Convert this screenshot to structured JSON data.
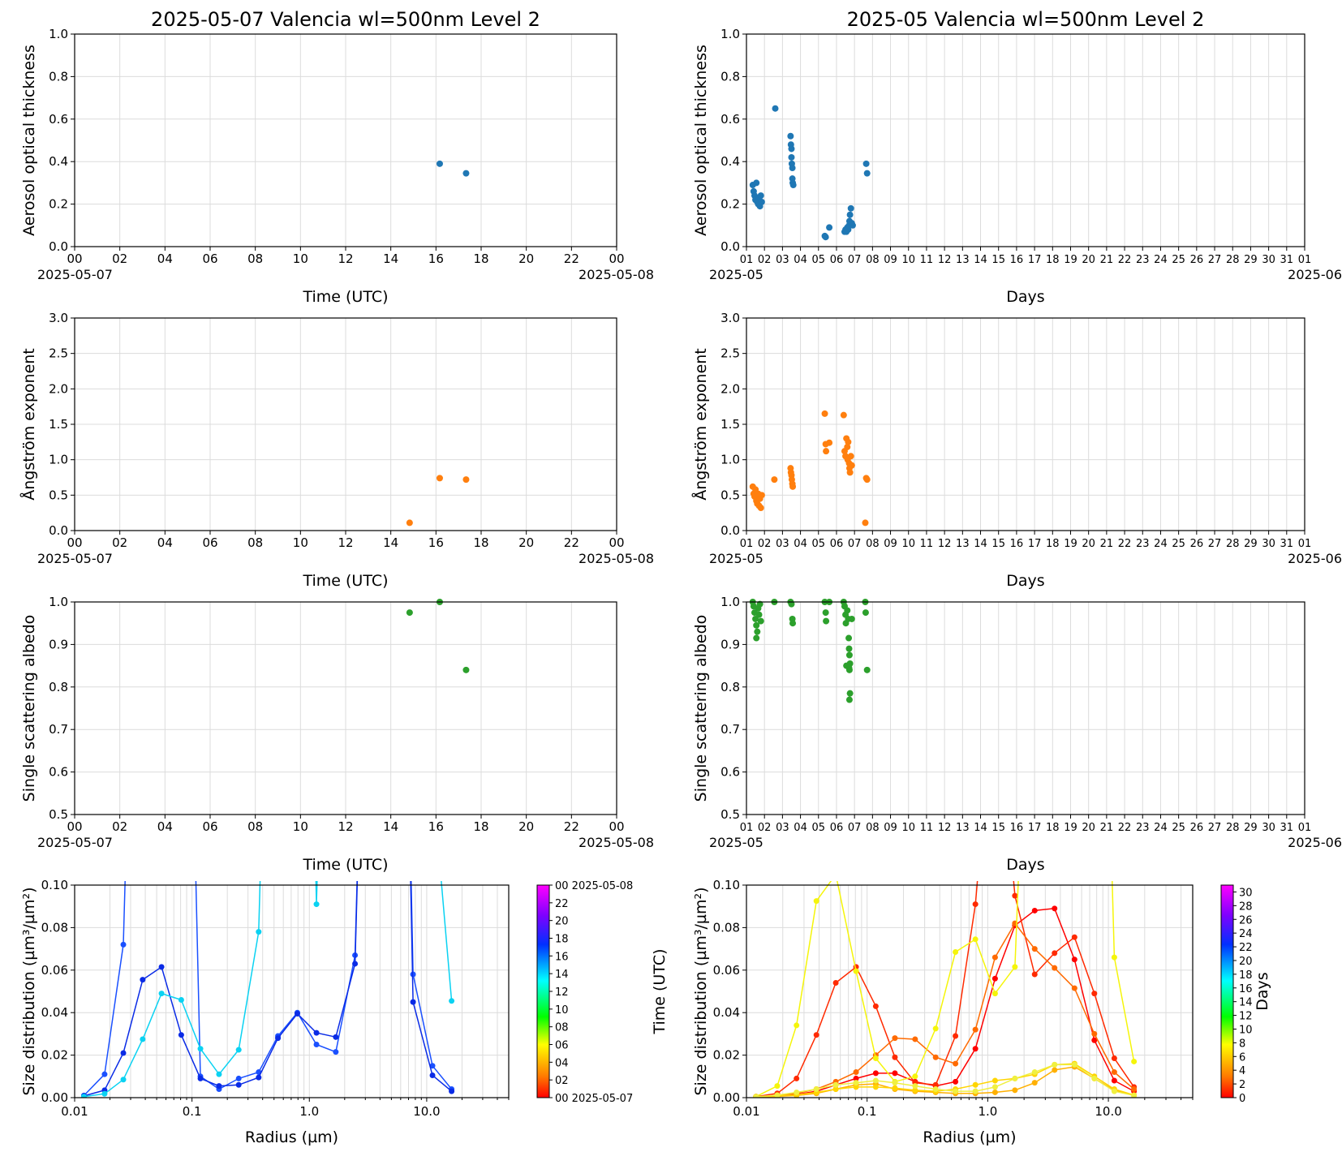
{
  "colors": {
    "aot": "#1f77b4",
    "ae": "#ff7f0e",
    "ssa": "#2ca02c"
  },
  "chart_data": [
    {
      "id": "daily-aot",
      "type": "scatter",
      "title": "2025-05-07  Valencia  wl=500nm  Level 2",
      "xlabel": "Time (UTC)",
      "ylabel": "Aerosol optical thickness",
      "xlim": [
        "2025-05-07 00:00",
        "2025-05-08 00:00"
      ],
      "ylim": [
        0,
        1.0
      ],
      "xticks": [
        "00",
        "02",
        "04",
        "06",
        "08",
        "10",
        "12",
        "14",
        "16",
        "18",
        "20",
        "22",
        "00"
      ],
      "yticks": [
        "0.0",
        "0.2",
        "0.4",
        "0.6",
        "0.8",
        "1.0"
      ],
      "date_start": "2025-05-07",
      "date_end": "2025-05-08",
      "grid": true,
      "points": [
        {
          "x": "2025-05-07 16:10",
          "y": 0.39
        },
        {
          "x": "2025-05-07 17:20",
          "y": 0.345
        }
      ]
    },
    {
      "id": "monthly-aot",
      "type": "scatter",
      "title": "2025-05  Valencia  wl=500nm  Level 2",
      "xlabel": "Days",
      "ylabel": "Aerosol optical thickness",
      "xlim": [
        "2025-05-01",
        "2025-06-01"
      ],
      "ylim": [
        0,
        1.0
      ],
      "xticks": [
        "01",
        "02",
        "03",
        "04",
        "05",
        "06",
        "07",
        "08",
        "09",
        "10",
        "11",
        "12",
        "13",
        "14",
        "15",
        "16",
        "17",
        "18",
        "19",
        "20",
        "21",
        "22",
        "23",
        "24",
        "25",
        "26",
        "27",
        "28",
        "29",
        "30",
        "31",
        "01"
      ],
      "yticks": [
        "0.0",
        "0.2",
        "0.4",
        "0.6",
        "0.8",
        "1.0"
      ],
      "date_start": "2025-05",
      "date_end": "2025-06",
      "grid": true,
      "points": [
        {
          "x": 1.35,
          "y": 0.29
        },
        {
          "x": 1.4,
          "y": 0.26
        },
        {
          "x": 1.45,
          "y": 0.24
        },
        {
          "x": 1.5,
          "y": 0.22
        },
        {
          "x": 1.55,
          "y": 0.3
        },
        {
          "x": 1.6,
          "y": 0.21
        },
        {
          "x": 1.65,
          "y": 0.2
        },
        {
          "x": 1.7,
          "y": 0.23
        },
        {
          "x": 1.75,
          "y": 0.19
        },
        {
          "x": 1.8,
          "y": 0.24
        },
        {
          "x": 1.85,
          "y": 0.21
        },
        {
          "x": 2.6,
          "y": 0.65
        },
        {
          "x": 3.45,
          "y": 0.52
        },
        {
          "x": 3.47,
          "y": 0.48
        },
        {
          "x": 3.5,
          "y": 0.46
        },
        {
          "x": 3.5,
          "y": 0.42
        },
        {
          "x": 3.52,
          "y": 0.39
        },
        {
          "x": 3.55,
          "y": 0.37
        },
        {
          "x": 3.55,
          "y": 0.32
        },
        {
          "x": 3.57,
          "y": 0.3
        },
        {
          "x": 3.6,
          "y": 0.29
        },
        {
          "x": 5.35,
          "y": 0.05
        },
        {
          "x": 5.4,
          "y": 0.045
        },
        {
          "x": 5.6,
          "y": 0.09
        },
        {
          "x": 6.45,
          "y": 0.07
        },
        {
          "x": 6.5,
          "y": 0.08
        },
        {
          "x": 6.55,
          "y": 0.07
        },
        {
          "x": 6.6,
          "y": 0.09
        },
        {
          "x": 6.65,
          "y": 0.08
        },
        {
          "x": 6.7,
          "y": 0.1
        },
        {
          "x": 6.72,
          "y": 0.12
        },
        {
          "x": 6.75,
          "y": 0.15
        },
        {
          "x": 6.8,
          "y": 0.18
        },
        {
          "x": 6.85,
          "y": 0.11
        },
        {
          "x": 6.9,
          "y": 0.1
        },
        {
          "x": 7.65,
          "y": 0.39
        },
        {
          "x": 7.7,
          "y": 0.345
        }
      ]
    },
    {
      "id": "daily-ae",
      "type": "scatter",
      "xlabel": "Time (UTC)",
      "ylabel": "Ångström exponent",
      "xlim": [
        "2025-05-07 00:00",
        "2025-05-08 00:00"
      ],
      "ylim": [
        0,
        3.0
      ],
      "xticks": [
        "00",
        "02",
        "04",
        "06",
        "08",
        "10",
        "12",
        "14",
        "16",
        "18",
        "20",
        "22",
        "00"
      ],
      "yticks": [
        "0.0",
        "0.5",
        "1.0",
        "1.5",
        "2.0",
        "2.5",
        "3.0"
      ],
      "date_start": "2025-05-07",
      "date_end": "2025-05-08",
      "grid": true,
      "points": [
        {
          "x": "2025-05-07 14:50",
          "y": 0.11
        },
        {
          "x": "2025-05-07 16:10",
          "y": 0.74
        },
        {
          "x": "2025-05-07 17:20",
          "y": 0.72
        }
      ]
    },
    {
      "id": "monthly-ae",
      "type": "scatter",
      "xlabel": "Days",
      "ylabel": "Ångström exponent",
      "xlim": [
        "2025-05-01",
        "2025-06-01"
      ],
      "ylim": [
        0,
        3.0
      ],
      "xticks": [
        "01",
        "02",
        "03",
        "04",
        "05",
        "06",
        "07",
        "08",
        "09",
        "10",
        "11",
        "12",
        "13",
        "14",
        "15",
        "16",
        "17",
        "18",
        "19",
        "20",
        "21",
        "22",
        "23",
        "24",
        "25",
        "26",
        "27",
        "28",
        "29",
        "30",
        "31",
        "01"
      ],
      "yticks": [
        "0.0",
        "0.5",
        "1.0",
        "1.5",
        "2.0",
        "2.5",
        "3.0"
      ],
      "date_start": "2025-05",
      "date_end": "2025-06",
      "grid": true,
      "points": [
        {
          "x": 1.35,
          "y": 0.62
        },
        {
          "x": 1.4,
          "y": 0.52
        },
        {
          "x": 1.45,
          "y": 0.48
        },
        {
          "x": 1.5,
          "y": 0.58
        },
        {
          "x": 1.55,
          "y": 0.42
        },
        {
          "x": 1.6,
          "y": 0.38
        },
        {
          "x": 1.65,
          "y": 0.52
        },
        {
          "x": 1.7,
          "y": 0.35
        },
        {
          "x": 1.75,
          "y": 0.45
        },
        {
          "x": 1.8,
          "y": 0.32
        },
        {
          "x": 1.85,
          "y": 0.5
        },
        {
          "x": 2.55,
          "y": 0.72
        },
        {
          "x": 3.45,
          "y": 0.88
        },
        {
          "x": 3.47,
          "y": 0.82
        },
        {
          "x": 3.5,
          "y": 0.78
        },
        {
          "x": 3.52,
          "y": 0.72
        },
        {
          "x": 3.55,
          "y": 0.66
        },
        {
          "x": 3.57,
          "y": 0.62
        },
        {
          "x": 5.35,
          "y": 1.65
        },
        {
          "x": 5.4,
          "y": 1.22
        },
        {
          "x": 5.42,
          "y": 1.12
        },
        {
          "x": 5.6,
          "y": 1.24
        },
        {
          "x": 6.4,
          "y": 1.63
        },
        {
          "x": 6.45,
          "y": 1.12
        },
        {
          "x": 6.5,
          "y": 1.05
        },
        {
          "x": 6.55,
          "y": 1.3
        },
        {
          "x": 6.6,
          "y": 1.18
        },
        {
          "x": 6.62,
          "y": 1.0
        },
        {
          "x": 6.65,
          "y": 1.25
        },
        {
          "x": 6.7,
          "y": 0.95
        },
        {
          "x": 6.72,
          "y": 0.88
        },
        {
          "x": 6.75,
          "y": 0.82
        },
        {
          "x": 6.8,
          "y": 1.05
        },
        {
          "x": 6.85,
          "y": 0.92
        },
        {
          "x": 7.6,
          "y": 0.11
        },
        {
          "x": 7.65,
          "y": 0.74
        },
        {
          "x": 7.7,
          "y": 0.72
        }
      ]
    },
    {
      "id": "daily-ssa",
      "type": "scatter",
      "xlabel": "Time (UTC)",
      "ylabel": "Single scattering albedo",
      "xlim": [
        "2025-05-07 00:00",
        "2025-05-08 00:00"
      ],
      "ylim": [
        0.5,
        1.0
      ],
      "xticks": [
        "00",
        "02",
        "04",
        "06",
        "08",
        "10",
        "12",
        "14",
        "16",
        "18",
        "20",
        "22",
        "00"
      ],
      "yticks": [
        "0.5",
        "0.6",
        "0.7",
        "0.8",
        "0.9",
        "1.0"
      ],
      "date_start": "2025-05-07",
      "date_end": "2025-05-08",
      "grid": true,
      "points": [
        {
          "x": "2025-05-07 14:50",
          "y": 0.975
        },
        {
          "x": "2025-05-07 16:10",
          "y": 1.0
        },
        {
          "x": "2025-05-07 17:20",
          "y": 0.84
        }
      ]
    },
    {
      "id": "monthly-ssa",
      "type": "scatter",
      "xlabel": "Days",
      "ylabel": "Single scattering albedo",
      "xlim": [
        "2025-05-01",
        "2025-06-01"
      ],
      "ylim": [
        0.5,
        1.0
      ],
      "xticks": [
        "01",
        "02",
        "03",
        "04",
        "05",
        "06",
        "07",
        "08",
        "09",
        "10",
        "11",
        "12",
        "13",
        "14",
        "15",
        "16",
        "17",
        "18",
        "19",
        "20",
        "21",
        "22",
        "23",
        "24",
        "25",
        "26",
        "27",
        "28",
        "29",
        "30",
        "31",
        "01"
      ],
      "yticks": [
        "0.5",
        "0.6",
        "0.7",
        "0.8",
        "0.9",
        "1.0"
      ],
      "date_start": "2025-05",
      "date_end": "2025-06",
      "grid": true,
      "points": [
        {
          "x": 1.35,
          "y": 1.0
        },
        {
          "x": 1.4,
          "y": 0.99
        },
        {
          "x": 1.45,
          "y": 0.975
        },
        {
          "x": 1.5,
          "y": 0.96
        },
        {
          "x": 1.55,
          "y": 0.945
        },
        {
          "x": 1.6,
          "y": 0.93
        },
        {
          "x": 1.55,
          "y": 0.915
        },
        {
          "x": 1.65,
          "y": 0.985
        },
        {
          "x": 1.7,
          "y": 0.97
        },
        {
          "x": 1.75,
          "y": 0.995
        },
        {
          "x": 1.8,
          "y": 0.955
        },
        {
          "x": 2.55,
          "y": 1.0
        },
        {
          "x": 3.45,
          "y": 1.0
        },
        {
          "x": 3.5,
          "y": 0.995
        },
        {
          "x": 3.55,
          "y": 0.96
        },
        {
          "x": 3.57,
          "y": 0.95
        },
        {
          "x": 5.35,
          "y": 1.0
        },
        {
          "x": 5.4,
          "y": 0.975
        },
        {
          "x": 5.42,
          "y": 0.955
        },
        {
          "x": 5.6,
          "y": 1.0
        },
        {
          "x": 6.4,
          "y": 1.0
        },
        {
          "x": 6.45,
          "y": 0.99
        },
        {
          "x": 6.5,
          "y": 0.97
        },
        {
          "x": 6.52,
          "y": 0.95
        },
        {
          "x": 6.55,
          "y": 0.85
        },
        {
          "x": 6.6,
          "y": 0.98
        },
        {
          "x": 6.65,
          "y": 0.96
        },
        {
          "x": 6.68,
          "y": 0.915
        },
        {
          "x": 6.7,
          "y": 0.89
        },
        {
          "x": 6.72,
          "y": 0.875
        },
        {
          "x": 6.75,
          "y": 0.855
        },
        {
          "x": 6.7,
          "y": 0.845
        },
        {
          "x": 6.72,
          "y": 0.84
        },
        {
          "x": 6.75,
          "y": 0.785
        },
        {
          "x": 6.72,
          "y": 0.77
        },
        {
          "x": 6.85,
          "y": 0.96
        },
        {
          "x": 7.6,
          "y": 1.0
        },
        {
          "x": 7.62,
          "y": 0.975
        },
        {
          "x": 7.7,
          "y": 0.84
        }
      ]
    },
    {
      "id": "daily-sd",
      "type": "line",
      "xlabel": "Radius (µm)",
      "ylabel": "Size distribution (µm³/µm²)",
      "xscale": "log",
      "xlim": [
        0.01,
        50
      ],
      "ylim": [
        0,
        0.1
      ],
      "xticks": [
        "0.01",
        "0.1",
        "1.0",
        "10.0"
      ],
      "yticks": [
        "0.00",
        "0.02",
        "0.04",
        "0.06",
        "0.08",
        "0.10"
      ],
      "colorbar": {
        "label": "Time (UTC)",
        "ticks": [
          "00 2025-05-07",
          "02",
          "04",
          "06",
          "08",
          "10",
          "12",
          "14",
          "16",
          "18",
          "20",
          "22",
          "00 2025-05-08"
        ]
      },
      "x": [
        0.012,
        0.018,
        0.026,
        0.038,
        0.055,
        0.081,
        0.118,
        0.17,
        0.25,
        0.37,
        0.54,
        0.79,
        1.15,
        1.68,
        2.45,
        3.58,
        5.24,
        7.65,
        11.2,
        16.3
      ],
      "series": [
        {
          "color": "#1a50ff",
          "values": [
            0.001,
            0.011,
            0.072,
            0.4,
            0.5,
            0.4,
            0.01,
            0.004,
            0.009,
            0.012,
            0.029,
            0.04,
            0.025,
            0.0215,
            0.067,
            0.4,
            0.5,
            0.058,
            0.015,
            0.004
          ]
        },
        {
          "color": "#0a2be6",
          "values": [
            0.0008,
            0.0035,
            0.021,
            0.0555,
            0.0615,
            0.0295,
            0.009,
            0.0055,
            0.006,
            0.0095,
            0.028,
            0.0395,
            0.0305,
            0.0285,
            0.063,
            0.4,
            0.5,
            0.045,
            0.0105,
            0.003
          ]
        },
        {
          "color": "#0ad2f2",
          "values": [
            0.0005,
            0.0018,
            0.0085,
            0.0275,
            0.049,
            0.046,
            0.023,
            0.011,
            0.0225,
            0.078,
            0.4,
            0.5,
            0.091,
            0.4,
            0.5,
            0.6,
            0.5,
            0.4,
            0.15,
            0.0455
          ]
        }
      ]
    },
    {
      "id": "monthly-sd",
      "type": "line",
      "xlabel": "Radius (µm)",
      "ylabel": "Size distribution (µm³/µm²)",
      "xscale": "log",
      "xlim": [
        0.01,
        50
      ],
      "ylim": [
        0,
        0.1
      ],
      "xticks": [
        "0.01",
        "0.1",
        "1.0",
        "10.0"
      ],
      "yticks": [
        "0.00",
        "0.02",
        "0.04",
        "0.06",
        "0.08",
        "0.10"
      ],
      "colorbar": {
        "label": "Days",
        "ticks": [
          "0",
          "2",
          "4",
          "6",
          "8",
          "10",
          "12",
          "14",
          "16",
          "18",
          "20",
          "22",
          "24",
          "26",
          "28",
          "30"
        ]
      },
      "x": [
        0.012,
        0.018,
        0.026,
        0.038,
        0.055,
        0.081,
        0.118,
        0.17,
        0.25,
        0.37,
        0.54,
        0.79,
        1.15,
        1.68,
        2.45,
        3.58,
        5.24,
        7.65,
        11.2,
        16.3
      ],
      "series": [
        {
          "color": "#ff0000",
          "values": [
            0.0005,
            0.001,
            0.0015,
            0.003,
            0.006,
            0.009,
            0.0115,
            0.0115,
            0.0075,
            0.0055,
            0.0075,
            0.023,
            0.056,
            0.081,
            0.088,
            0.089,
            0.065,
            0.027,
            0.008,
            0.003
          ]
        },
        {
          "color": "#ff2a00",
          "values": [
            0.0005,
            0.002,
            0.009,
            0.0295,
            0.054,
            0.0615,
            0.043,
            0.019,
            0.007,
            0.006,
            0.029,
            0.091,
            0.2,
            0.095,
            0.058,
            0.068,
            0.0755,
            0.049,
            0.0185,
            0.005
          ]
        },
        {
          "color": "#ff6a00",
          "values": [
            0.0005,
            0.001,
            0.002,
            0.004,
            0.0075,
            0.012,
            0.02,
            0.028,
            0.0275,
            0.019,
            0.016,
            0.032,
            0.066,
            0.082,
            0.07,
            0.061,
            0.0515,
            0.03,
            0.012,
            0.004
          ]
        },
        {
          "color": "#ffb000",
          "values": [
            0.0003,
            0.0006,
            0.001,
            0.002,
            0.004,
            0.006,
            0.0065,
            0.004,
            0.003,
            0.0025,
            0.002,
            0.002,
            0.0025,
            0.0035,
            0.007,
            0.013,
            0.0145,
            0.009,
            0.0035,
            0.001
          ]
        },
        {
          "color": "#ffd500",
          "values": [
            0.0003,
            0.0008,
            0.0013,
            0.0025,
            0.004,
            0.005,
            0.005,
            0.0045,
            0.0035,
            0.003,
            0.004,
            0.006,
            0.008,
            0.009,
            0.011,
            0.0155,
            0.016,
            0.01,
            0.004,
            0.0012
          ]
        },
        {
          "color": "#f5f50a",
          "values": [
            0.0005,
            0.0055,
            0.034,
            0.0925,
            0.105,
            0.0595,
            0.0185,
            0.0075,
            0.01,
            0.0325,
            0.0685,
            0.0745,
            0.049,
            0.0615,
            0.3,
            0.5,
            0.5,
            0.4,
            0.066,
            0.017
          ]
        },
        {
          "color": "#f0f040",
          "values": [
            0.0004,
            0.0012,
            0.0025,
            0.004,
            0.006,
            0.007,
            0.008,
            0.007,
            0.0055,
            0.004,
            0.003,
            0.003,
            0.005,
            0.009,
            0.012,
            0.0155,
            0.0155,
            0.009,
            0.003,
            0.001
          ]
        }
      ]
    }
  ]
}
